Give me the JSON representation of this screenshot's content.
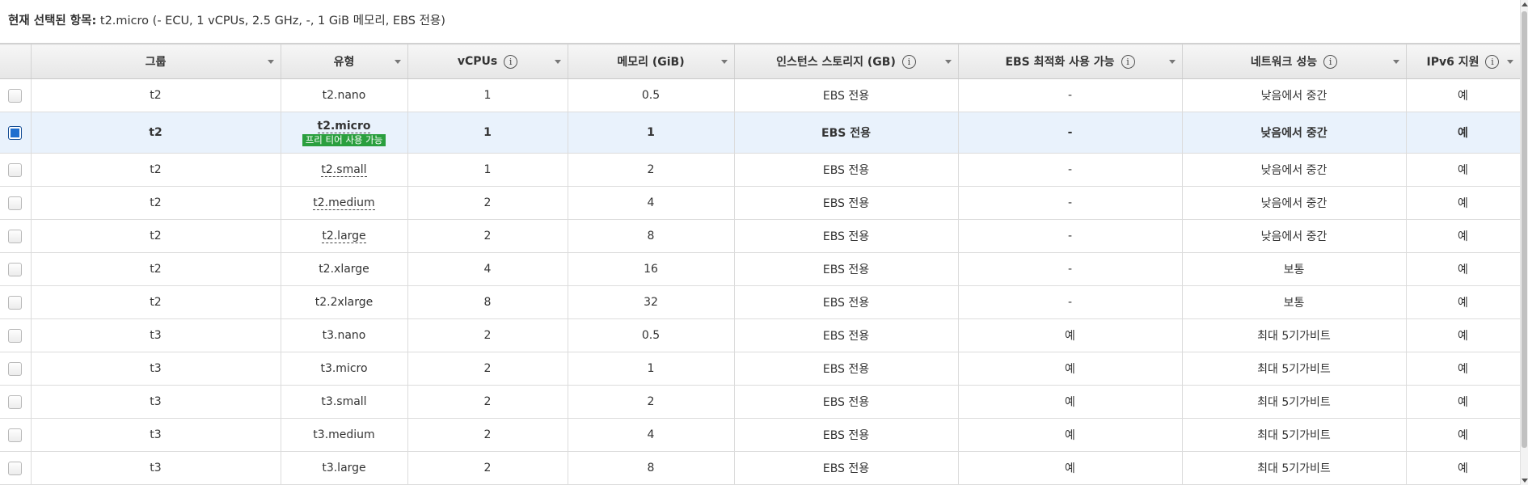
{
  "selected": {
    "label": "현재 선택된 항목:",
    "value": "t2.micro (- ECU, 1 vCPUs, 2.5 GHz, -, 1 GiB 메모리, EBS 전용)"
  },
  "columns": {
    "group": "그룹",
    "type": "유형",
    "vcpus": "vCPUs",
    "memory": "메모리 (GiB)",
    "storage": "인스턴스 스토리지 (GB)",
    "ebs": "EBS 최적화 사용 가능",
    "network": "네트워크 성능",
    "ipv6": "IPv6 지원"
  },
  "info_glyph": "i",
  "free_tier_badge": "프리 티어 사용 가능",
  "rows": [
    {
      "group": "t2",
      "type": "t2.nano",
      "vcpus": "1",
      "memory": "0.5",
      "storage": "EBS 전용",
      "ebs": "-",
      "network": "낮음에서 중간",
      "ipv6": "예",
      "checked": false,
      "selected": false,
      "free_tier": false,
      "type_link": false
    },
    {
      "group": "t2",
      "type": "t2.micro",
      "vcpus": "1",
      "memory": "1",
      "storage": "EBS 전용",
      "ebs": "-",
      "network": "낮음에서 중간",
      "ipv6": "예",
      "checked": true,
      "selected": true,
      "free_tier": true,
      "type_link": true
    },
    {
      "group": "t2",
      "type": "t2.small",
      "vcpus": "1",
      "memory": "2",
      "storage": "EBS 전용",
      "ebs": "-",
      "network": "낮음에서 중간",
      "ipv6": "예",
      "checked": false,
      "selected": false,
      "free_tier": false,
      "type_link": true
    },
    {
      "group": "t2",
      "type": "t2.medium",
      "vcpus": "2",
      "memory": "4",
      "storage": "EBS 전용",
      "ebs": "-",
      "network": "낮음에서 중간",
      "ipv6": "예",
      "checked": false,
      "selected": false,
      "free_tier": false,
      "type_link": true
    },
    {
      "group": "t2",
      "type": "t2.large",
      "vcpus": "2",
      "memory": "8",
      "storage": "EBS 전용",
      "ebs": "-",
      "network": "낮음에서 중간",
      "ipv6": "예",
      "checked": false,
      "selected": false,
      "free_tier": false,
      "type_link": true
    },
    {
      "group": "t2",
      "type": "t2.xlarge",
      "vcpus": "4",
      "memory": "16",
      "storage": "EBS 전용",
      "ebs": "-",
      "network": "보통",
      "ipv6": "예",
      "checked": false,
      "selected": false,
      "free_tier": false,
      "type_link": false
    },
    {
      "group": "t2",
      "type": "t2.2xlarge",
      "vcpus": "8",
      "memory": "32",
      "storage": "EBS 전용",
      "ebs": "-",
      "network": "보통",
      "ipv6": "예",
      "checked": false,
      "selected": false,
      "free_tier": false,
      "type_link": false
    },
    {
      "group": "t3",
      "type": "t3.nano",
      "vcpus": "2",
      "memory": "0.5",
      "storage": "EBS 전용",
      "ebs": "예",
      "network": "최대 5기가비트",
      "ipv6": "예",
      "checked": false,
      "selected": false,
      "free_tier": false,
      "type_link": false
    },
    {
      "group": "t3",
      "type": "t3.micro",
      "vcpus": "2",
      "memory": "1",
      "storage": "EBS 전용",
      "ebs": "예",
      "network": "최대 5기가비트",
      "ipv6": "예",
      "checked": false,
      "selected": false,
      "free_tier": false,
      "type_link": false
    },
    {
      "group": "t3",
      "type": "t3.small",
      "vcpus": "2",
      "memory": "2",
      "storage": "EBS 전용",
      "ebs": "예",
      "network": "최대 5기가비트",
      "ipv6": "예",
      "checked": false,
      "selected": false,
      "free_tier": false,
      "type_link": false
    },
    {
      "group": "t3",
      "type": "t3.medium",
      "vcpus": "2",
      "memory": "4",
      "storage": "EBS 전용",
      "ebs": "예",
      "network": "최대 5기가비트",
      "ipv6": "예",
      "checked": false,
      "selected": false,
      "free_tier": false,
      "type_link": false
    },
    {
      "group": "t3",
      "type": "t3.large",
      "vcpus": "2",
      "memory": "8",
      "storage": "EBS 전용",
      "ebs": "예",
      "network": "최대 5기가비트",
      "ipv6": "예",
      "checked": false,
      "selected": false,
      "free_tier": false,
      "type_link": false
    }
  ]
}
